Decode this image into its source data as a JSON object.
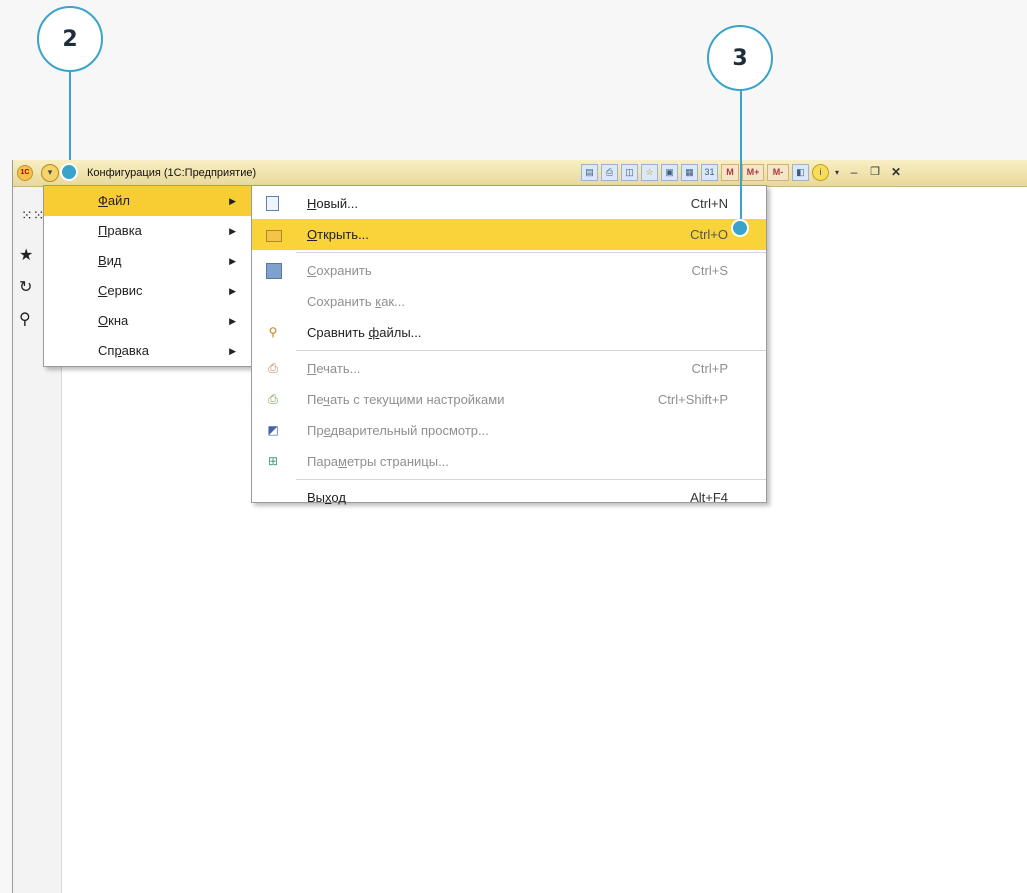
{
  "callouts": {
    "c2": "2",
    "c3": "3"
  },
  "titlebar": {
    "app_title": "Конфигурация  (1С:Предприятие)",
    "logo_text": "1С",
    "icons": [
      "doc-icon",
      "print-icon",
      "preview-icon",
      "favorite-icon",
      "history-icon",
      "calc-icon",
      "calendar-icon"
    ],
    "memory_buttons": [
      "M",
      "M+",
      "M-"
    ],
    "window_controls": [
      "–",
      "🗗",
      "✕"
    ]
  },
  "sidebar": {
    "icons": [
      "apps-grid-icon",
      "star-icon",
      "history-icon",
      "search-icon"
    ]
  },
  "main_menu": {
    "items": [
      {
        "pre": "",
        "ul": "Ф",
        "post": "айл",
        "selected": true
      },
      {
        "pre": "",
        "ul": "П",
        "post": "равка",
        "selected": false
      },
      {
        "pre": "",
        "ul": "В",
        "post": "ид",
        "selected": false
      },
      {
        "pre": "",
        "ul": "С",
        "post": "ервис",
        "selected": false
      },
      {
        "pre": "",
        "ul": "О",
        "post": "кна",
        "selected": false
      },
      {
        "pre": "Сп",
        "ul": "р",
        "post": "авка",
        "selected": false
      }
    ]
  },
  "file_menu": {
    "items": [
      {
        "pre": "",
        "ul": "Н",
        "post": "овый...",
        "shortcut": "Ctrl+N",
        "enabled": true,
        "selected": false,
        "icon": "new-document-icon"
      },
      {
        "pre": "",
        "ul": "О",
        "post": "ткрыть...",
        "shortcut": "Ctrl+O",
        "enabled": true,
        "selected": true,
        "icon": "open-folder-icon"
      },
      {
        "pre": "",
        "ul": "С",
        "post": "охранить",
        "shortcut": "Ctrl+S",
        "enabled": false,
        "selected": false,
        "icon": "save-icon"
      },
      {
        "pre": "Сохранить ",
        "ul": "к",
        "post": "ак...",
        "shortcut": "",
        "enabled": false,
        "selected": false,
        "icon": ""
      },
      {
        "pre": "Сравнить ",
        "ul": "ф",
        "post": "айлы...",
        "shortcut": "",
        "enabled": true,
        "selected": false,
        "icon": "compare-files-icon"
      },
      {
        "pre": "",
        "ul": "П",
        "post": "ечать...",
        "shortcut": "Ctrl+P",
        "enabled": false,
        "selected": false,
        "icon": "print-icon"
      },
      {
        "pre": "Пе",
        "ul": "ч",
        "post": "ать с текущими настройками",
        "shortcut": "Ctrl+Shift+P",
        "enabled": false,
        "selected": false,
        "icon": "quick-print-icon"
      },
      {
        "pre": "Пр",
        "ul": "е",
        "post": "дварительный просмотр...",
        "shortcut": "",
        "enabled": false,
        "selected": false,
        "icon": "print-preview-icon"
      },
      {
        "pre": "Пара",
        "ul": "м",
        "post": "етры страницы...",
        "shortcut": "",
        "enabled": false,
        "selected": false,
        "icon": "page-setup-icon"
      },
      {
        "pre": "Вы",
        "ul": "х",
        "post": "од",
        "shortcut": "Alt+F4",
        "enabled": true,
        "selected": false,
        "icon": ""
      }
    ]
  }
}
